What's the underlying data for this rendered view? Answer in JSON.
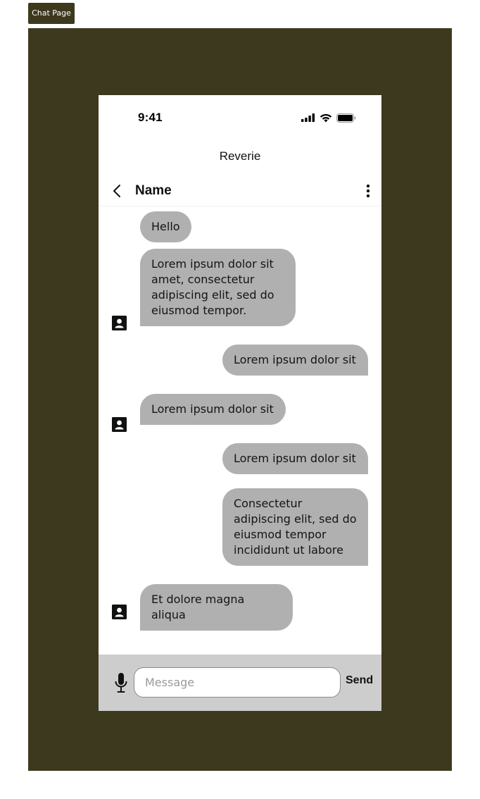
{
  "page_tag": "Chat Page",
  "status_bar": {
    "time": "9:41",
    "icons": [
      "cellular-signal-icon",
      "wifi-icon",
      "battery-icon"
    ]
  },
  "app": {
    "title": "Reverie"
  },
  "header": {
    "contact_name": "Name",
    "icons": [
      "chevron-left-icon",
      "more-vertical-icon"
    ]
  },
  "messages": [
    {
      "side": "incoming",
      "text": "Hello",
      "avatar": false
    },
    {
      "side": "incoming",
      "text": "Lorem ipsum dolor sit amet, consectetur adipiscing elit, sed do eiusmod tempor.",
      "avatar": true
    },
    {
      "side": "outgoing",
      "text": "Lorem ipsum dolor sit"
    },
    {
      "side": "incoming",
      "text": "Lorem ipsum dolor sit",
      "avatar": true
    },
    {
      "side": "outgoing",
      "text": "Lorem ipsum dolor sit"
    },
    {
      "side": "outgoing",
      "text": "Consectetur adipiscing elit, sed do eiusmod tempor incididunt ut labore"
    },
    {
      "side": "incoming",
      "text": "Et dolore magna aliqua",
      "avatar": true
    }
  ],
  "composer": {
    "placeholder": "Message",
    "value": "",
    "send_label": "Send",
    "mic_icon": "microphone-icon"
  },
  "colors": {
    "frame": "#3d391e",
    "bubble": "#b0b0b0",
    "composer": "#cdcdcd"
  }
}
